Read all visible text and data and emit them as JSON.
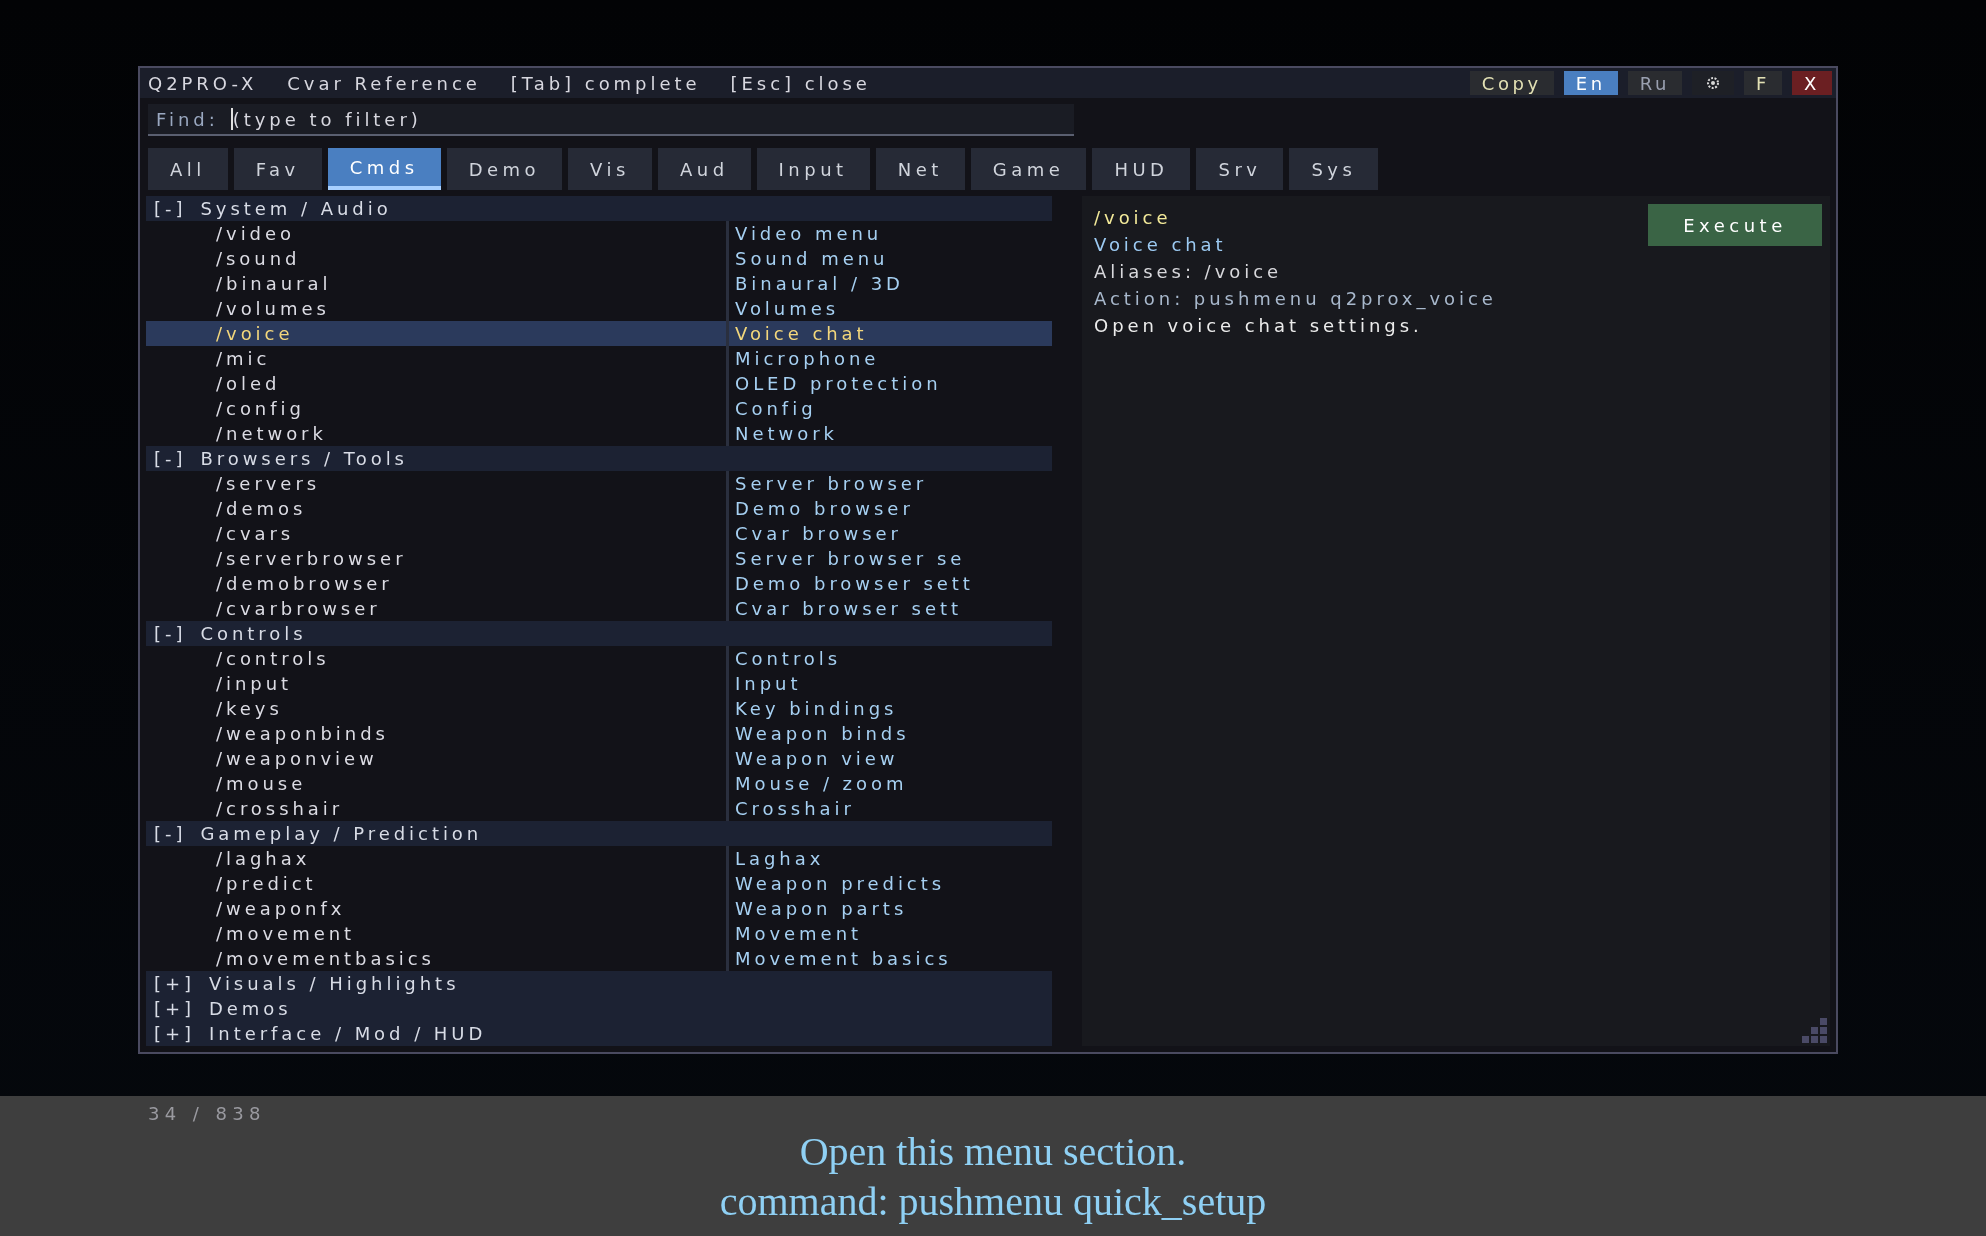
{
  "title_bar": {
    "texts": [
      "Q2PRO-X",
      "Cvar Reference",
      "[Tab] complete",
      "[Esc] close"
    ],
    "buttons": [
      {
        "kind": "action",
        "label": "Copy"
      },
      {
        "kind": "lang",
        "label": "En",
        "selected": true
      },
      {
        "kind": "lang",
        "label": "Ru",
        "selected": false
      },
      {
        "kind": "settings"
      },
      {
        "kind": "action",
        "label": "F"
      },
      {
        "kind": "close",
        "label": "X"
      }
    ]
  },
  "find": {
    "label": "Find:",
    "placeholder": "(type to filter)"
  },
  "tabs": [
    {
      "label": "All",
      "selected": false
    },
    {
      "label": "Fav",
      "selected": false
    },
    {
      "label": "Cmds",
      "selected": true
    },
    {
      "label": "Demo",
      "selected": false
    },
    {
      "label": "Vis",
      "selected": false
    },
    {
      "label": "Aud",
      "selected": false
    },
    {
      "label": "Input",
      "selected": false
    },
    {
      "label": "Net",
      "selected": false
    },
    {
      "label": "Game",
      "selected": false
    },
    {
      "label": "HUD",
      "selected": false
    },
    {
      "label": "Srv",
      "selected": false
    },
    {
      "label": "Sys",
      "selected": false
    }
  ],
  "groups": [
    {
      "toggle": "[-]",
      "title": "System / Audio",
      "items": [
        {
          "command": "/video",
          "description": "Video menu",
          "selected": false
        },
        {
          "command": "/sound",
          "description": "Sound menu",
          "selected": false
        },
        {
          "command": "/binaural",
          "description": "Binaural / 3D",
          "selected": false
        },
        {
          "command": "/volumes",
          "description": "Volumes",
          "selected": false
        },
        {
          "command": "/voice",
          "description": "Voice chat",
          "selected": true
        },
        {
          "command": "/mic",
          "description": "Microphone",
          "selected": false
        },
        {
          "command": "/oled",
          "description": "OLED protection",
          "selected": false
        },
        {
          "command": "/config",
          "description": "Config",
          "selected": false
        },
        {
          "command": "/network",
          "description": "Network",
          "selected": false
        }
      ]
    },
    {
      "toggle": "[-]",
      "title": "Browsers / Tools",
      "items": [
        {
          "command": "/servers",
          "description": "Server browser",
          "selected": false
        },
        {
          "command": "/demos",
          "description": "Demo browser",
          "selected": false
        },
        {
          "command": "/cvars",
          "description": "Cvar browser",
          "selected": false
        },
        {
          "command": "/serverbrowser",
          "description": "Server browser se",
          "selected": false
        },
        {
          "command": "/demobrowser",
          "description": "Demo browser sett",
          "selected": false
        },
        {
          "command": "/cvarbrowser",
          "description": "Cvar browser sett",
          "selected": false
        }
      ]
    },
    {
      "toggle": "[-]",
      "title": "Controls",
      "items": [
        {
          "command": "/controls",
          "description": "Controls",
          "selected": false
        },
        {
          "command": "/input",
          "description": "Input",
          "selected": false
        },
        {
          "command": "/keys",
          "description": "Key bindings",
          "selected": false
        },
        {
          "command": "/weaponbinds",
          "description": "Weapon binds",
          "selected": false
        },
        {
          "command": "/weaponview",
          "description": "Weapon view",
          "selected": false
        },
        {
          "command": "/mouse",
          "description": "Mouse / zoom",
          "selected": false
        },
        {
          "command": "/crosshair",
          "description": "Crosshair",
          "selected": false
        }
      ]
    },
    {
      "toggle": "[-]",
      "title": "Gameplay / Prediction",
      "items": [
        {
          "command": "/laghax",
          "description": "Laghax",
          "selected": false
        },
        {
          "command": "/predict",
          "description": "Weapon predicts",
          "selected": false
        },
        {
          "command": "/weaponfx",
          "description": "Weapon parts",
          "selected": false
        },
        {
          "command": "/movement",
          "description": "Movement",
          "selected": false
        },
        {
          "command": "/movementbasics",
          "description": "Movement basics",
          "selected": false
        }
      ]
    },
    {
      "toggle": "[+]",
      "title": "Visuals / Highlights"
    },
    {
      "toggle": "[+]",
      "title": "Demos"
    },
    {
      "toggle": "[+]",
      "title": "Interface / Mod / HUD"
    }
  ],
  "detail": {
    "command": "/voice",
    "title": "Voice chat",
    "aliases": "Aliases: /voice",
    "action": "Action: pushmenu q2prox_voice",
    "description": "Open voice chat settings.",
    "execute": "Execute"
  },
  "footer": {
    "counter": "34 / 838",
    "caption_lines": [
      "Open this menu section.",
      "command: pushmenu quick_setup"
    ]
  }
}
